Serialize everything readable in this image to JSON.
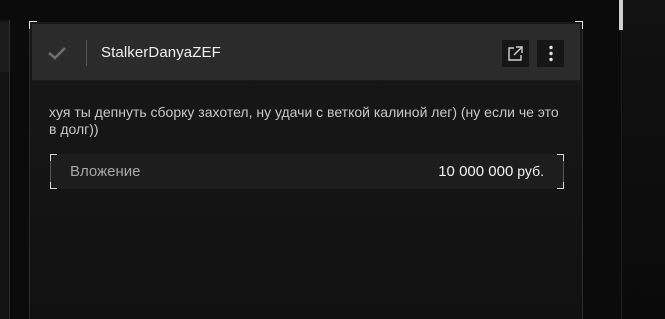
{
  "message_card": {
    "username": "StalkerDanyaZEF",
    "body_text": "хуя ты депнуть сборку захотел, ну удачи с веткой калиной лег) (ну если че это в долг))",
    "attachment": {
      "label": "Вложение",
      "amount": "10 000 000",
      "currency": "руб."
    },
    "icons": {
      "check": "check-icon",
      "open": "external-link-icon",
      "menu": "more-vertical-icon"
    }
  },
  "colors": {
    "background": "#0b0b0b",
    "card": "#151515",
    "header": "#2b2b2b",
    "button": "#161616",
    "text_primary": "#f0f0f0",
    "text_secondary": "#a8a8a8"
  }
}
